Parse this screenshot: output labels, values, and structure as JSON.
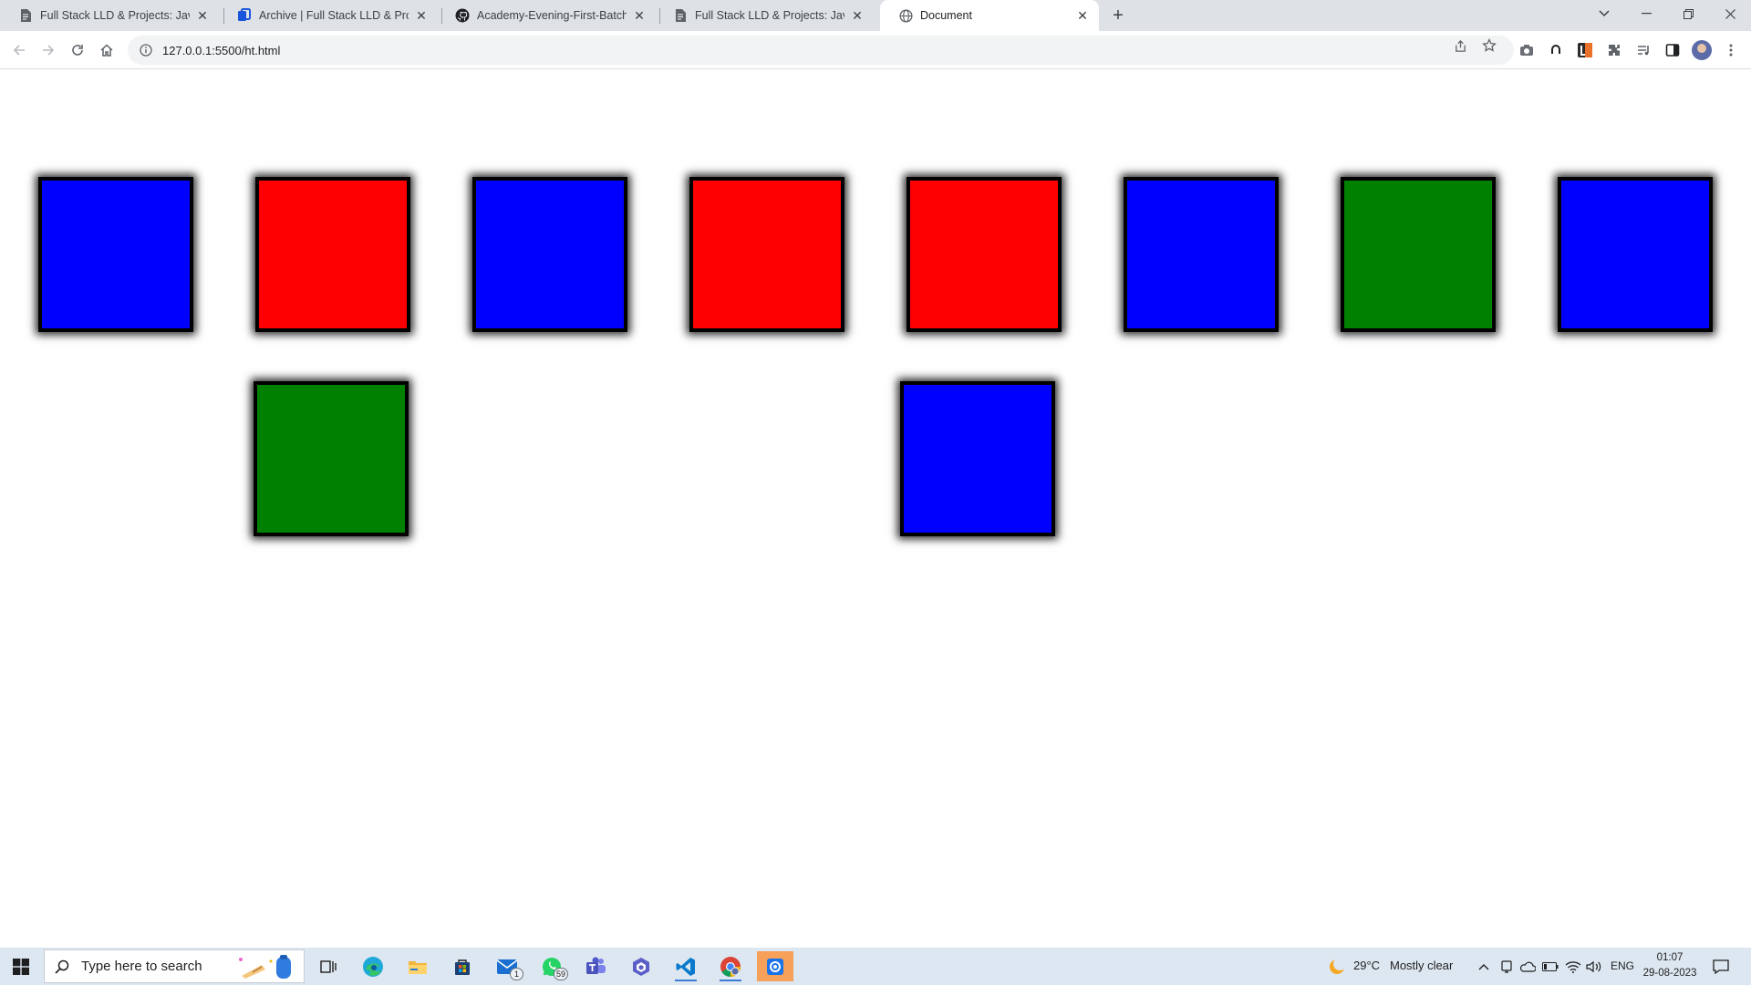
{
  "browser": {
    "tabs": [
      {
        "title": "Full Stack LLD & Projects: JavaScript",
        "icon": "document-icon",
        "active": false
      },
      {
        "title": "Archive | Full Stack LLD & Projects",
        "icon": "archive-icon",
        "active": false
      },
      {
        "title": "Academy-Evening-First-Batch--Full",
        "icon": "github-icon",
        "active": false
      },
      {
        "title": "Full Stack LLD & Projects: JavaScript",
        "icon": "document-icon",
        "active": false
      },
      {
        "title": "Document",
        "icon": "globe-icon",
        "active": true
      }
    ],
    "address_bar": {
      "url": "127.0.0.1:5500/ht.html"
    }
  },
  "page": {
    "boxes": [
      {
        "color": "blue"
      },
      {
        "color": "red"
      },
      {
        "color": "blue"
      },
      {
        "color": "red"
      },
      {
        "color": "red"
      },
      {
        "color": "blue"
      },
      {
        "color": "green"
      },
      {
        "color": "blue"
      },
      {
        "color": "green"
      },
      {
        "color": "blue"
      }
    ]
  },
  "taskbar": {
    "search_placeholder": "Type here to search",
    "mail_badge": "1",
    "whatsapp_badge": "59",
    "weather": {
      "temp": "29°C",
      "condition": "Mostly clear"
    },
    "language": "ENG",
    "time": "01:07",
    "date": "29-08-2023"
  },
  "colors": {
    "blue": "#0000ff",
    "red": "#ff0000",
    "green": "#008000",
    "tabstrip": "#dee1e6",
    "taskbar": "#dde7f1"
  }
}
